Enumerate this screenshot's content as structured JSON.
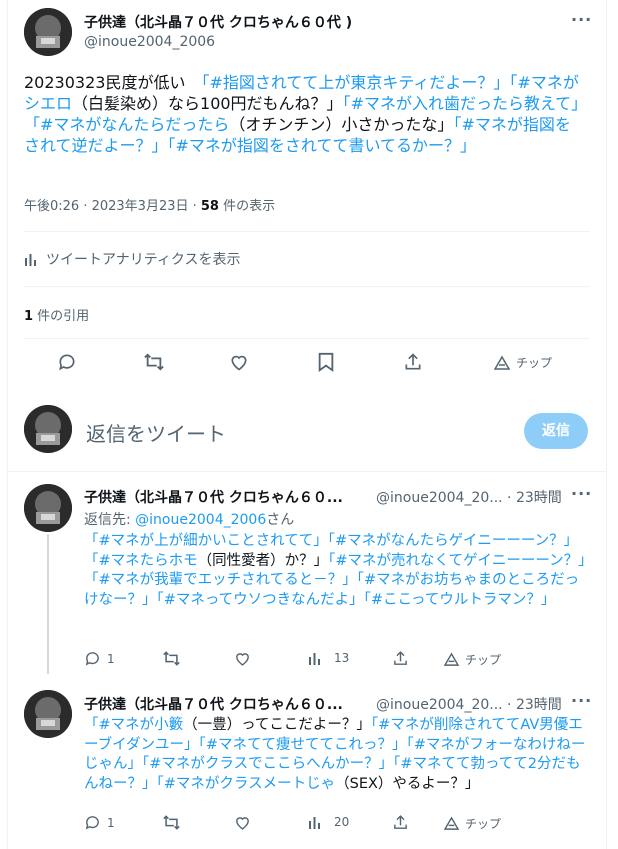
{
  "main": {
    "author_name": "子供達（北斗晶７０代 クロちゃん６０代 )",
    "author_handle": "@inoue2004_2006",
    "more": "···",
    "text_segments": [
      {
        "t": "20230323民度が低い　",
        "h": false
      },
      {
        "t": "「#指図されてて上が東京キティだよー？」「#マネがシエロ",
        "h": true
      },
      {
        "t": "（白髪染め）なら100円だもんね？」",
        "h": false
      },
      {
        "t": "「#マネが入れ歯だったら教えて」「#マネがなんたらだったら",
        "h": true
      },
      {
        "t": "（オチンチン）小さかったな」",
        "h": false
      },
      {
        "t": "「#マネが指図をされて逆だよー？」「#マネが指図をされてて書いてるかー？」",
        "h": true
      }
    ],
    "timestamp": "午後0:26 · 2023年3月23日 · ",
    "views_count": "58",
    "views_label": " 件の表示",
    "analytics": "ツイートアナリティクスを表示",
    "quotes_count": "1",
    "quotes_label": " 件の引用",
    "tip": "チップ"
  },
  "compose": {
    "placeholder": "返信をツイート",
    "button": "返信"
  },
  "replies": [
    {
      "author_name": "子供達（北斗晶７０代 クロちゃん６０...",
      "author_handle": "@inoue2004_20...",
      "time": " · 23時間",
      "more": "···",
      "reply_to_prefix": "返信先: ",
      "reply_to_handle": "@inoue2004_2006",
      "reply_to_suffix": "さん",
      "text_segments": [
        {
          "t": "「#マネが上が細かいことされてて」「#マネがなんたらゲイニーーーン？」「#マネたらホモ",
          "h": true
        },
        {
          "t": "（同性愛者）か？」",
          "h": false
        },
        {
          "t": "「#マネが売れなくてゲイニーーーン？」「#マネが我輩でエッチされてると－？」「#マネがお坊ちゃまのところだっけなー？」「#マネってウソつきなんだよ」「#ここってウルトラマン？」",
          "h": true
        }
      ],
      "reply_count": "1",
      "views_count": "13",
      "tip": "チップ"
    },
    {
      "author_name": "子供達（北斗晶７０代 クロちゃん６０...",
      "author_handle": "@inoue2004_20...",
      "time": " · 23時間",
      "more": "···",
      "text_segments": [
        {
          "t": "「#マネが小籔",
          "h": true
        },
        {
          "t": "（一豊）ってここだよー？」",
          "h": false
        },
        {
          "t": "「#マネが削除されててAV男優エーブイダンユー」「#マネてて痩せててこれっ？」「#マネがフォーなわけねーじゃん」「#マネがクラスでここらへんかー？」「#マネてて勃ってて2分だもんねー？」「#マネがクラスメートじゃ",
          "h": true
        },
        {
          "t": "（SEX）やるよー？」",
          "h": false
        }
      ],
      "reply_count": "1",
      "views_count": "20",
      "tip": "チップ"
    }
  ]
}
